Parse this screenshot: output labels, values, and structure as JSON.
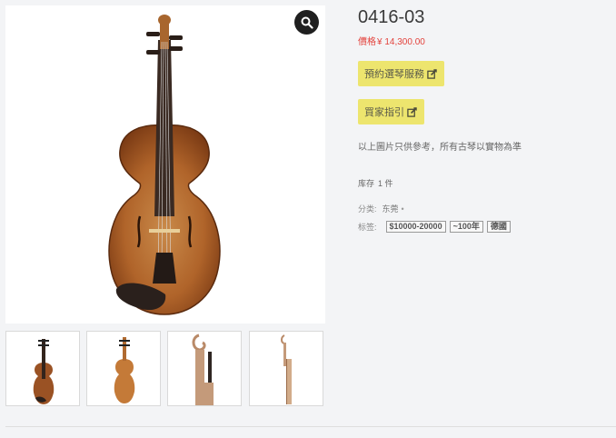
{
  "product": {
    "title": "0416-03",
    "price_label": "價格",
    "price_value": "¥ 14,300.00",
    "buttons": {
      "appointment": "預約選琴服務",
      "buyer_guide": "買家指引"
    },
    "note": "以上圖片只供參考，所有古琴以實物為準",
    "stock_label": "库存",
    "stock_value": "1 件",
    "category_label": "分类:",
    "category_value": "东莞",
    "category_dot": "•",
    "tags_label": "标签:",
    "tags": [
      "$10000-20000",
      "~100年",
      "德國"
    ]
  },
  "icons": {
    "zoom": "magnifier-icon",
    "edit": "edit-external-icon"
  },
  "colors": {
    "price": "#e3433d",
    "button_bg": "#ede56e",
    "zoom_bg": "#1f1f1f"
  }
}
